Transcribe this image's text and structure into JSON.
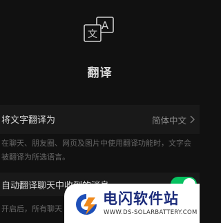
{
  "header": {
    "icon": "translate-icon",
    "icon_glyph_a": "A",
    "icon_glyph_wen": "文",
    "title": "翻译"
  },
  "translate_text_setting": {
    "label": "将文字翻译为",
    "value": "简体中文",
    "chevron_icon": "chevron-right-icon",
    "description": "在聊天、朋友圈、网页及图片中使用翻译功能时，文字会被翻译为所选语言。"
  },
  "auto_translate_setting": {
    "label": "自动翻译聊天中收到的消息",
    "enabled": true,
    "description": "开启后，所有聊天"
  },
  "watermark": {
    "title": "电闪软件站",
    "url": "WWW.DS-SOLARBATTERY.COM"
  },
  "colors": {
    "background": "#111111",
    "row_background": "#191919",
    "toggle_on": "#07c160",
    "watermark_title": "#1a2a7a",
    "watermark_logo_blue": "#1e4fb8",
    "watermark_logo_orange": "#f08a1c"
  }
}
